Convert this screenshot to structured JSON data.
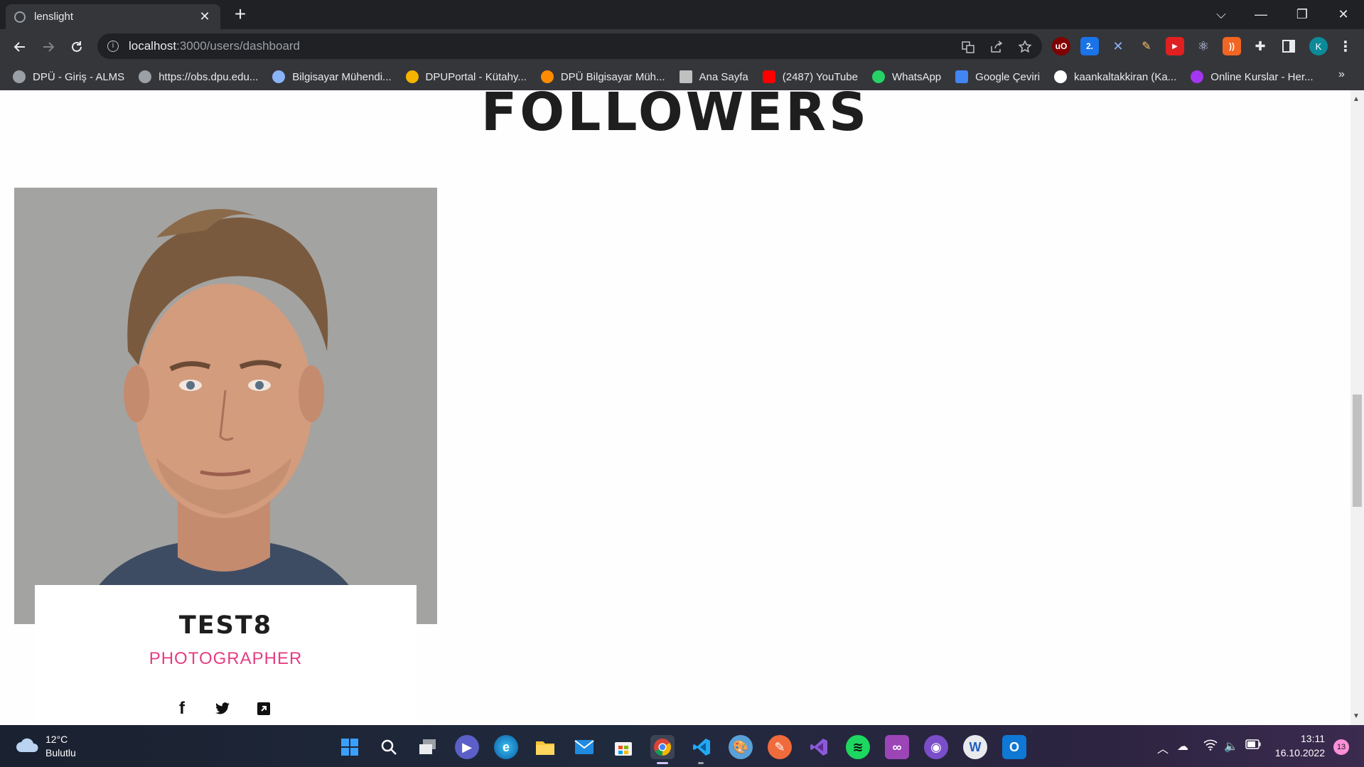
{
  "browser": {
    "tab": {
      "title": "lenslight",
      "close_glyph": "✕",
      "icon": "globe-icon"
    },
    "new_tab_glyph": "+",
    "window_controls": {
      "dropdown": "⌵",
      "minimize": "—",
      "restore": "❐",
      "close": "✕"
    },
    "address": {
      "host": "localhost",
      "path": ":3000/users/dashboard"
    },
    "profile_initial": "K",
    "extensions": [
      "ublock",
      "2.el",
      "tools",
      "pencil",
      "youtube-ext",
      "react-devtools",
      "rss",
      "puzzle"
    ],
    "bookmarks": [
      {
        "label": "DPÜ - Giriş - ALMS",
        "color": "#9aa0a6"
      },
      {
        "label": "https://obs.dpu.edu...",
        "color": "#9aa0a6"
      },
      {
        "label": "Bilgisayar Mühendi...",
        "color": "#8ab4f8"
      },
      {
        "label": "DPUPortal - Kütahy...",
        "color": "#f4b400"
      },
      {
        "label": "DPÜ Bilgisayar Müh...",
        "color": "#ff8c00"
      },
      {
        "label": "Ana Sayfa",
        "color": "#c0c0c0"
      },
      {
        "label": "(2487) YouTube",
        "color": "#ff0000"
      },
      {
        "label": "WhatsApp",
        "color": "#25d366"
      },
      {
        "label": "Google Çeviri",
        "color": "#4285f4"
      },
      {
        "label": "kaankaltakkiran (Ka...",
        "color": "#ffffff"
      },
      {
        "label": "Online Kurslar - Her...",
        "color": "#a435f0"
      }
    ],
    "bookmarks_more": "»"
  },
  "page": {
    "title": "FOLLOWERS",
    "follower": {
      "name": "TEST8",
      "role": "PHOTOGRAPHER",
      "social": {
        "facebook": "f",
        "twitter": "🐦",
        "external": "↗"
      }
    }
  },
  "taskbar": {
    "weather": {
      "temp": "12°C",
      "desc": "Bulutlu"
    },
    "clock": {
      "time": "13:11",
      "date": "16.10.2022"
    },
    "notifications": "13"
  },
  "colors": {
    "accent_role": "#e53d82",
    "title_text": "#1e1e1e",
    "chrome_dark": "#202124",
    "chrome_toolbar": "#35363a"
  }
}
